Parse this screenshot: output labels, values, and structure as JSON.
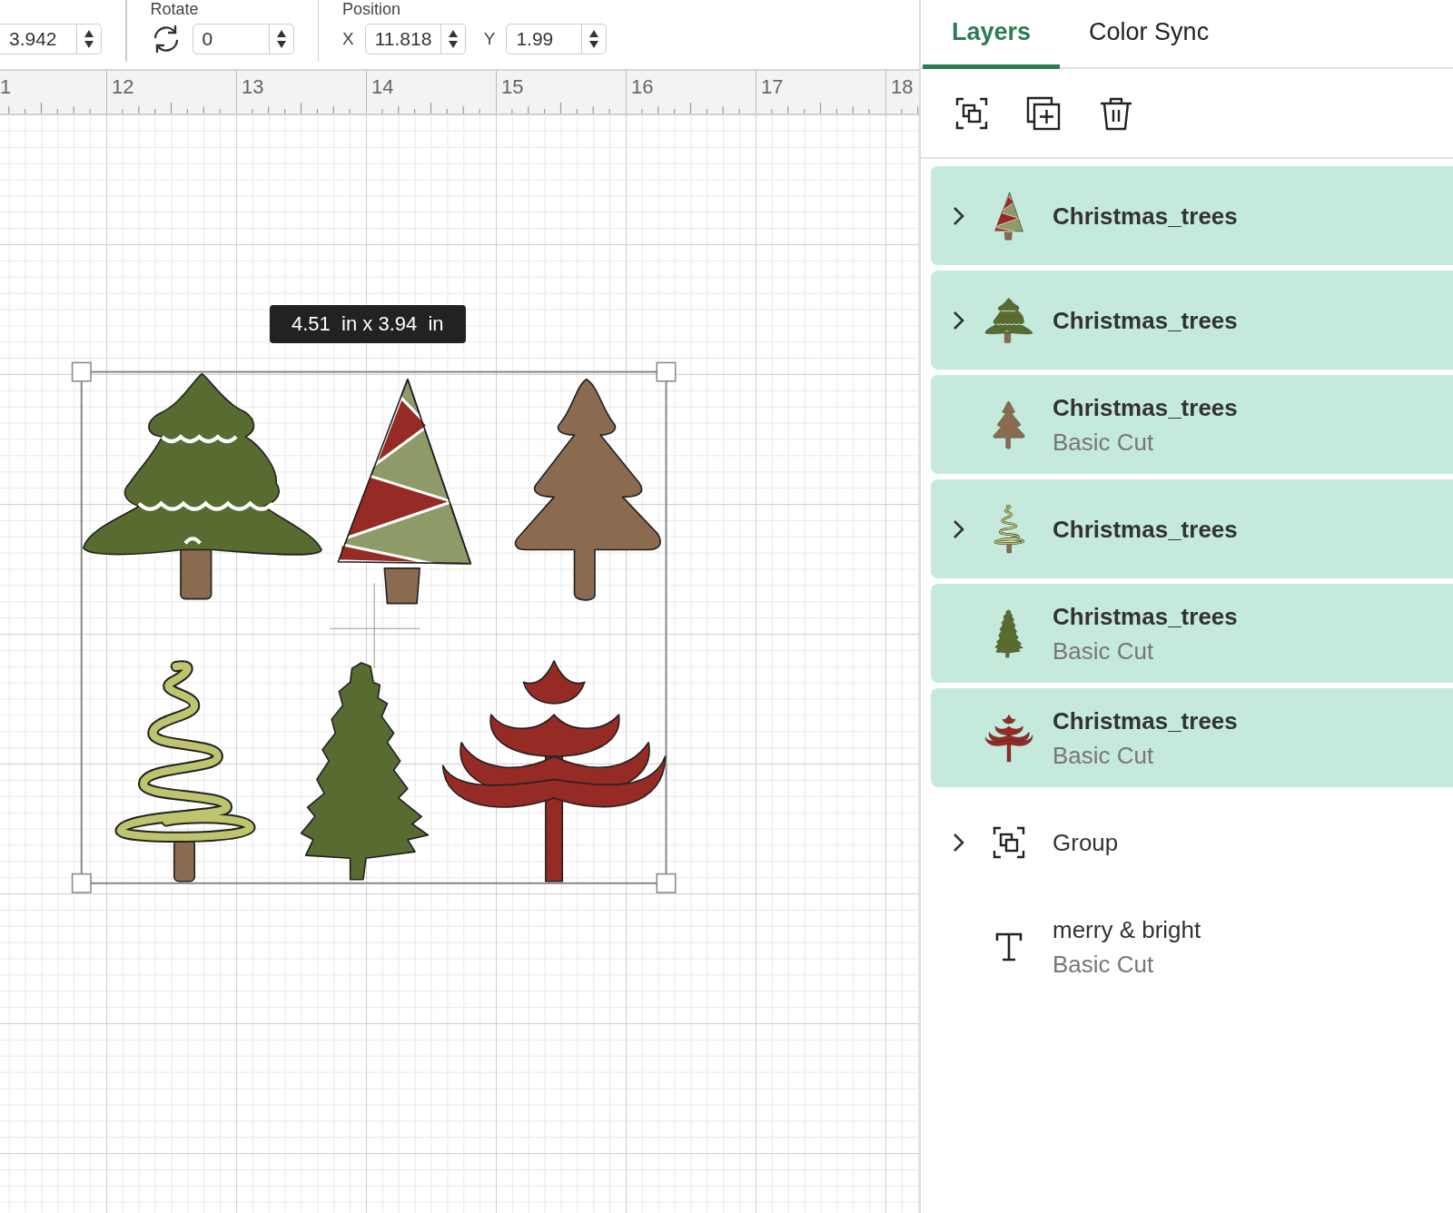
{
  "toolbar": {
    "size_field": {
      "value": "3.942"
    },
    "rotate": {
      "label": "Rotate",
      "value": "0"
    },
    "position": {
      "label": "Position",
      "x_label": "X",
      "x_value": "11.818",
      "y_label": "Y",
      "y_value": "1.99"
    }
  },
  "ruler": {
    "labels": [
      "1",
      "12",
      "13",
      "14",
      "15",
      "16",
      "17",
      "18"
    ]
  },
  "canvas": {
    "size_tooltip": "4.51  in x 3.94  in"
  },
  "panel": {
    "tabs": [
      {
        "label": "Layers",
        "selected": true
      },
      {
        "label": "Color Sync",
        "selected": false
      }
    ],
    "layers": [
      {
        "kind": "striped-tree",
        "name": "Christmas_trees",
        "expandable": true,
        "selected": true
      },
      {
        "kind": "snowy-tree",
        "name": "Christmas_trees",
        "expandable": true,
        "selected": true
      },
      {
        "kind": "fir-tree",
        "name": "Christmas_trees",
        "subtitle": "Basic Cut",
        "expandable": false,
        "selected": true
      },
      {
        "kind": "spiral-tree",
        "name": "Christmas_trees",
        "expandable": true,
        "selected": true
      },
      {
        "kind": "pine-tree",
        "name": "Christmas_trees",
        "subtitle": "Basic Cut",
        "expandable": false,
        "selected": true
      },
      {
        "kind": "branch-tree",
        "name": "Christmas_trees",
        "subtitle": "Basic Cut",
        "expandable": false,
        "selected": true
      },
      {
        "kind": "group",
        "name": "Group",
        "expandable": true,
        "selected": false
      },
      {
        "kind": "text",
        "name": "merry & bright",
        "subtitle": "Basic Cut",
        "expandable": false,
        "selected": false
      }
    ]
  }
}
